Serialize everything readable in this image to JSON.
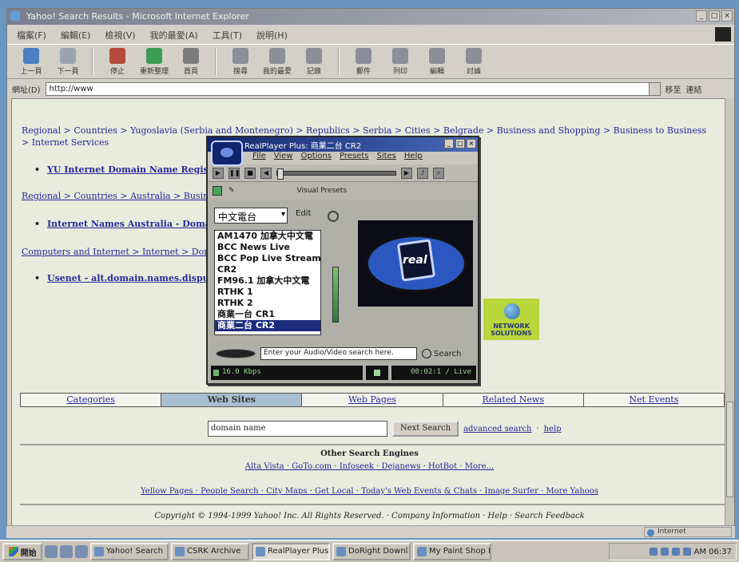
{
  "ie": {
    "title": "Yahoo! Search Results - Microsoft Internet Explorer",
    "menu": [
      "檔案(F)",
      "編輯(E)",
      "檢視(V)",
      "我的最愛(A)",
      "工具(T)",
      "說明(H)"
    ],
    "toolbar": [
      "上一頁",
      "下一頁",
      "停止",
      "重新整理",
      "首頁",
      "搜尋",
      "我的最愛",
      "記錄",
      "郵件",
      "列印",
      "編輯",
      "討論"
    ],
    "address_label": "網址(D)",
    "address_value": "http://www",
    "go_label": "移至",
    "links_label": "連結"
  },
  "content": {
    "crumb1": "Regional > Countries > Yugoslavia (Serbia and Montenegro) > Republics > Serbia > Cities > Belgrade > Business and Shopping > Business to Business > Internet Services",
    "bullet1": "YU Internet Domain Name Registration",
    "crumb2": "Regional > Countries > Australia > Business",
    "bullet2": "Internet Names Australia - Domain",
    "crumb3": "Computers and Internet > Internet > Domain",
    "bullet3": "Usenet - alt.domain.names.dispute",
    "netsol": "NETWORK SOLUTIONS",
    "tabs": [
      "Categories",
      "Web Sites",
      "Web Pages",
      "Related News",
      "Net Events"
    ],
    "search_value": "domain name",
    "search_button": "Next Search",
    "advanced": "advanced search",
    "help": "help",
    "other_title": "Other Search Engines",
    "engines": "Alta Vista · GoTo.com · Infoseek · Dejanews · HotBot · More...",
    "footer_links": "Yellow Pages · People Search · City Maps · Get Local · Today's Web Events & Chats · Image Surfer · More Yahoos",
    "copyright": "Copyright © 1994-1999 Yahoo! Inc. All Rights Reserved. · Company Information · Help · Search Feedback"
  },
  "status": {
    "zone": "Internet"
  },
  "taskbar": {
    "start": "開始",
    "tasks": [
      "Yahoo! Search",
      "CSRK Archive",
      "RealPlayer Plus",
      "DoRight Downl",
      "My Paint Shop Pro"
    ],
    "active_index": 2,
    "time": "AM 06:37"
  },
  "realplayer": {
    "title": "RealPlayer Plus: 商業二台 CR2",
    "menu": [
      "File",
      "View",
      "Options",
      "Presets",
      "Sites",
      "Help"
    ],
    "visual_presets": "Visual Presets",
    "preset_select": "中文電台",
    "edit_label": "Edit",
    "stations": [
      "AM1470 加拿大中文電",
      "BCC News Live",
      "BCC Pop Live Stream",
      "CR2",
      "FM96.1 加拿大中文電",
      "RTHK 1",
      "RTHK 2",
      "商業一台 CR1",
      "商業二台 CR2"
    ],
    "selected_station_index": 8,
    "video_logo_text": "real",
    "search_placeholder": "Enter your Audio/Video search here.",
    "search_button": "Search",
    "status_left": "16.0 Kbps",
    "status_right": "00:02:1 / Live"
  }
}
